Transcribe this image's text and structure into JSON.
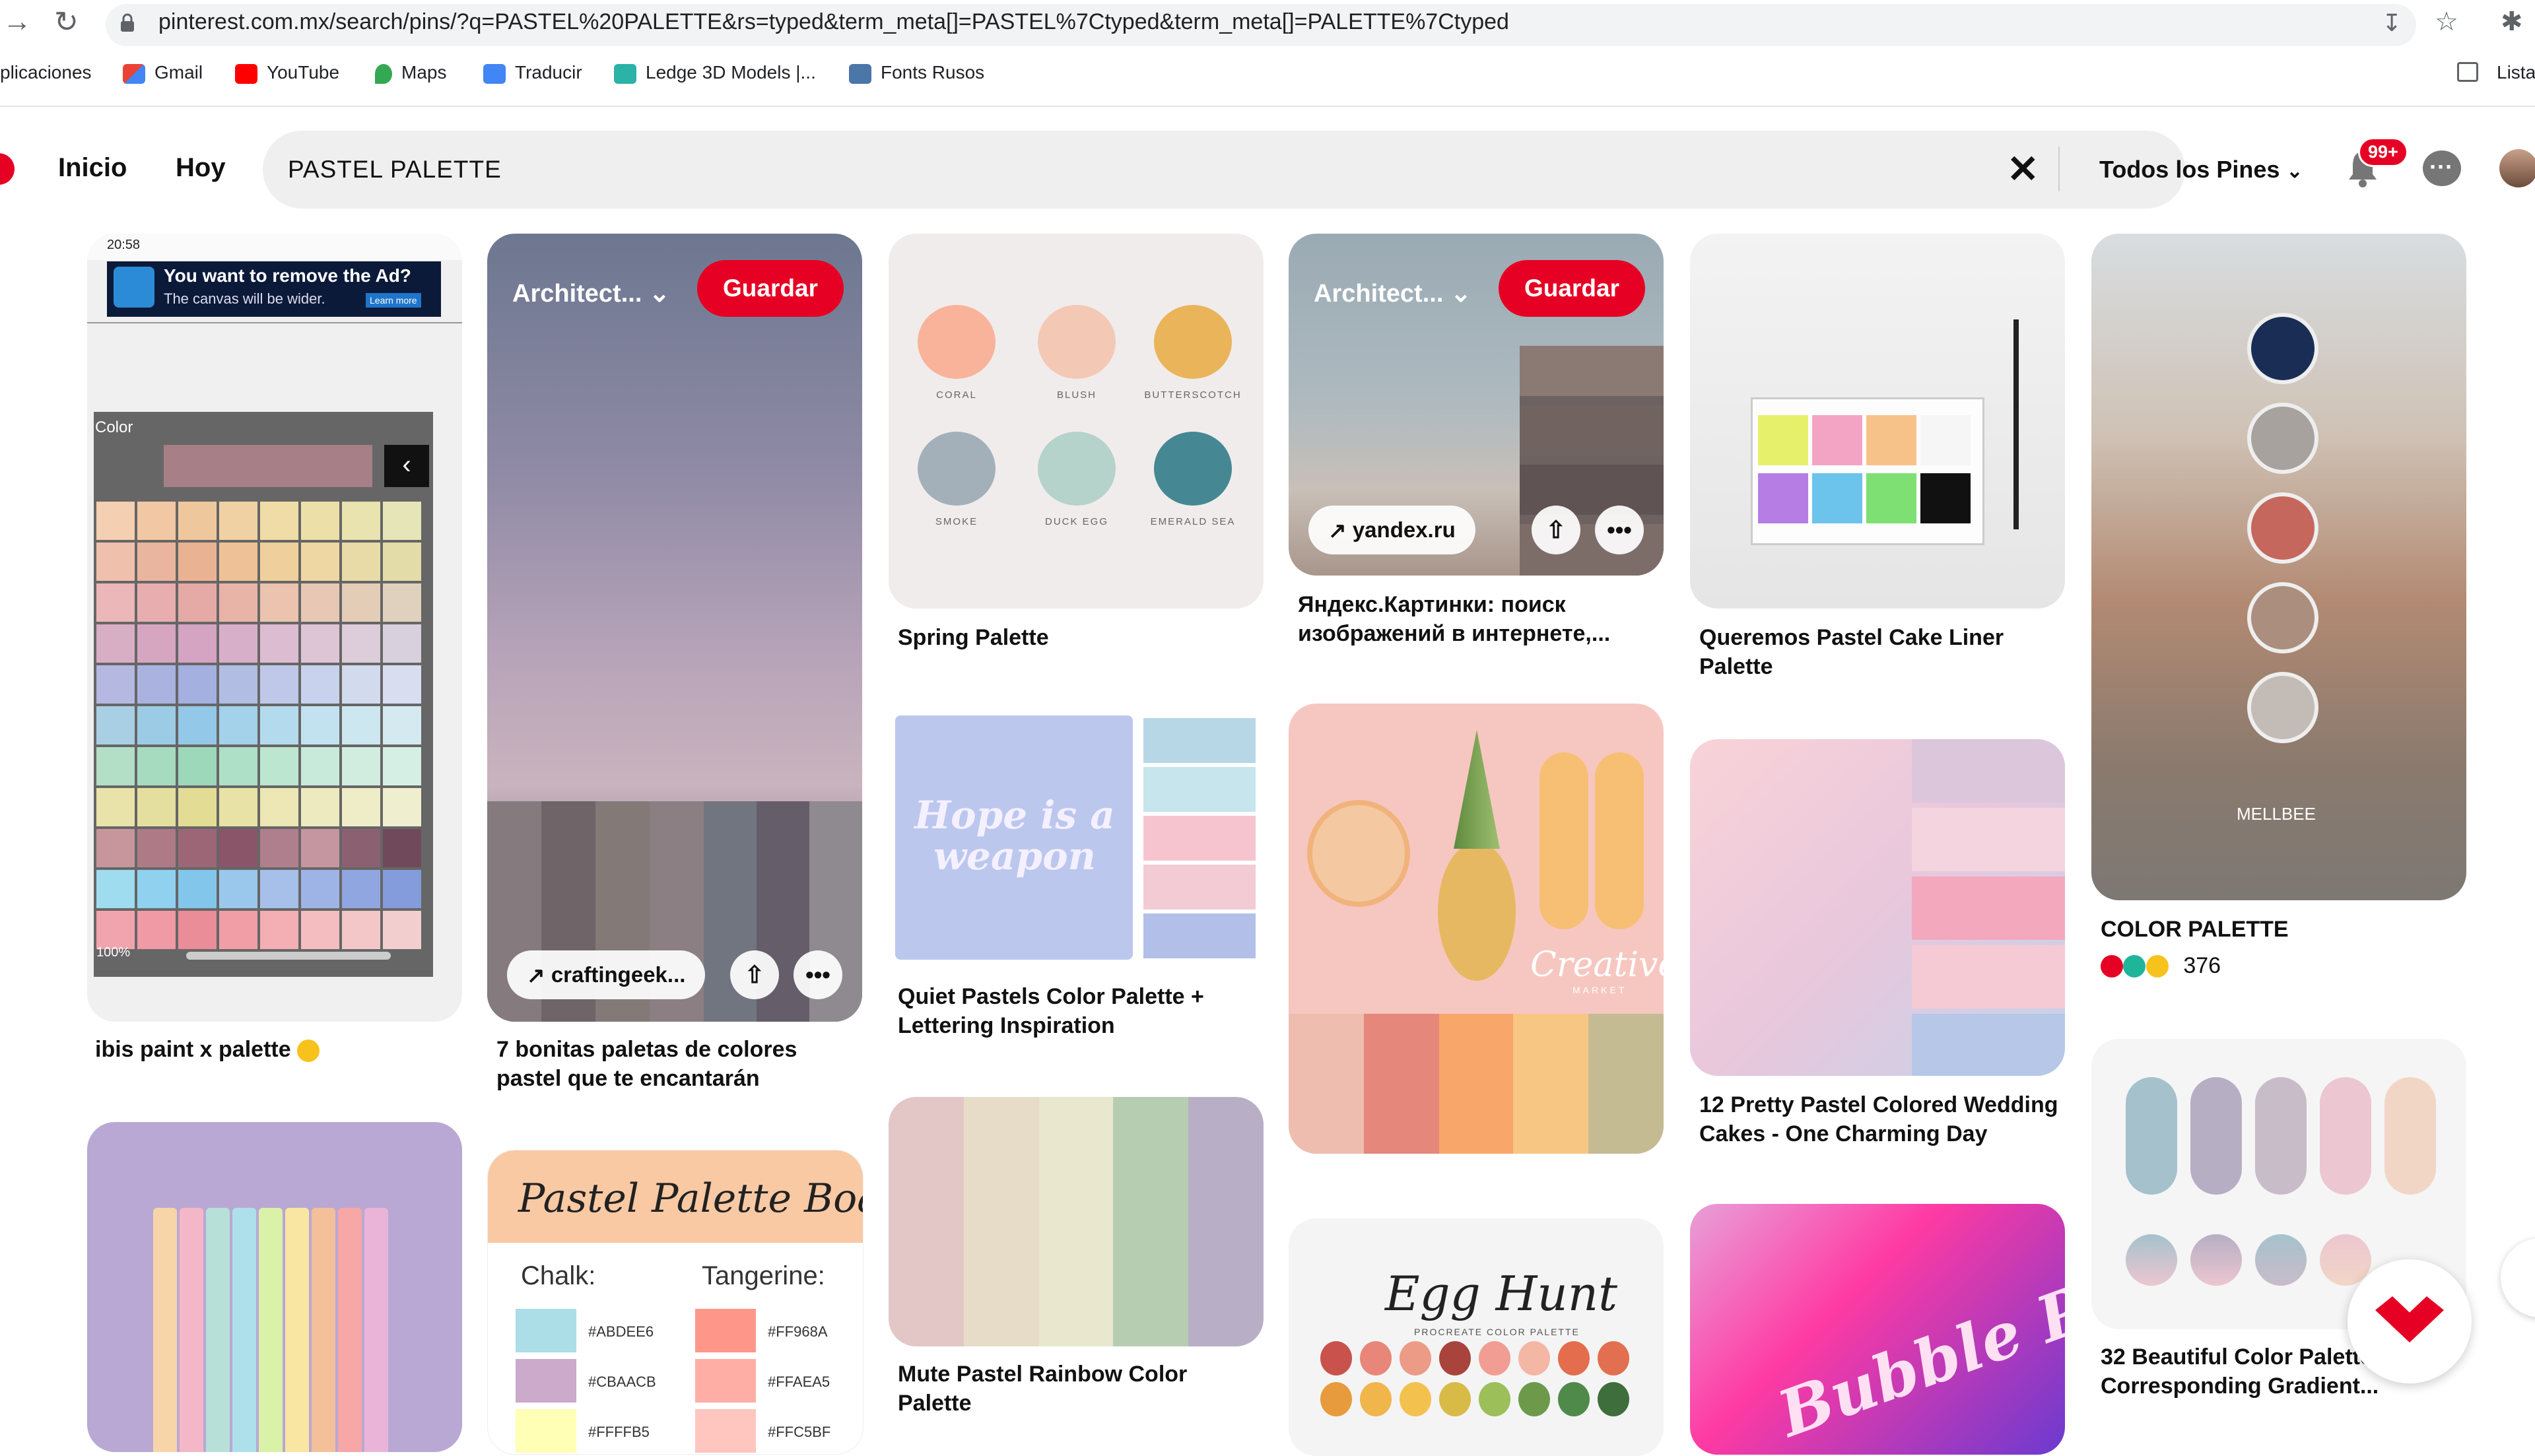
{
  "browser": {
    "url": "pinterest.com.mx/search/pins/?q=PASTEL%20PALETTE&rs=typed&term_meta[]=PASTEL%7Ctyped&term_meta[]=PALETTE%7Ctyped",
    "bookmarks": [
      "plicaciones",
      "Gmail",
      "YouTube",
      "Maps",
      "Traducir",
      "Ledge 3D Models |...",
      "Fonts Rusos"
    ],
    "reading_list": "Lista"
  },
  "header": {
    "nav": [
      "Inicio",
      "Hoy"
    ],
    "search_value": "PASTEL PALETTE",
    "filter_label": "Todos los Pines",
    "notification_badge": "99+"
  },
  "pins": {
    "ibis": {
      "status_time": "20:58",
      "ad_title": "You want to remove the Ad?",
      "ad_sub": "The canvas will be wider.",
      "ad_button": "Learn more",
      "panel_label": "Color",
      "zoom": "100%",
      "title": "ibis paint x palette"
    },
    "clouds": {
      "board": "Architect...",
      "save": "Guardar",
      "link": "craftingeek...",
      "title": "7 bonitas paletas de colores pastel que te encantarán"
    },
    "spring": {
      "swatches": [
        "CORAL",
        "BLUSH",
        "BUTTERSCOTCH",
        "SMOKE",
        "DUCK EGG",
        "EMERALD SEA"
      ],
      "title": "Spring Palette"
    },
    "yandex": {
      "board": "Architect...",
      "save": "Guardar",
      "link": "yandex.ru",
      "title": "Яндекс.Картинки: поиск изображений в интернете,..."
    },
    "cakeliner": {
      "title": "Queremos Pastel Cake Liner Palette"
    },
    "colorpalette": {
      "watermark": "MELLBEE",
      "title": "COLOR PALETTE",
      "reactions": "376"
    },
    "hope": {
      "art_text": "Hope is a weapon",
      "title": "Quiet Pastels Color Palette + Lettering Inspiration"
    },
    "pineapple": {
      "watermark": "Creative",
      "watermark_sub": "MARKET"
    },
    "wedding": {
      "title": "12 Pretty Pastel Colored Wedding Cakes - One Charming Day"
    },
    "rainbow": {
      "title": "Mute Pastel Rainbow Color Palette"
    },
    "board": {
      "heading": "Pastel Palette Board",
      "col1": "Chalk:",
      "col2": "Tangerine:",
      "codes1": [
        "#ABDEE6",
        "#CBAACB",
        "#FFFFB5"
      ],
      "codes2": [
        "#FF968A",
        "#FFAEA5",
        "#FFC5BF"
      ]
    },
    "egghunt": {
      "heading": "Egg Hunt",
      "sub": "PROCREATE COLOR PALETTE"
    },
    "bubble": {
      "text": "Bubble Pop"
    },
    "gradient": {
      "title": "32 Beautiful Color Palettes Their Corresponding Gradient..."
    }
  },
  "colors": {
    "pinterest_red": "#e60023",
    "search_bg": "#efefef"
  }
}
